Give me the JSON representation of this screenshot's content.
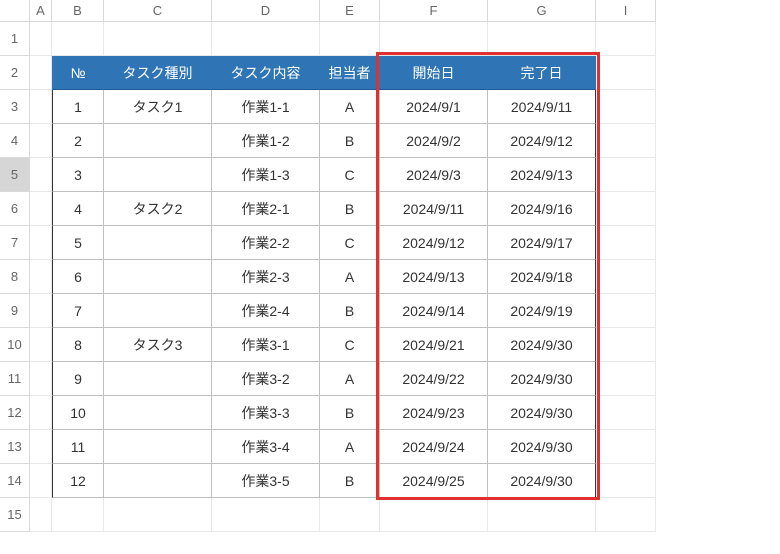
{
  "selected_row_header": 5,
  "col_letters": [
    "A",
    "B",
    "C",
    "D",
    "E",
    "F",
    "G",
    "I"
  ],
  "row_numbers_visible": [
    1,
    2,
    3,
    4,
    5,
    6,
    7,
    8,
    9,
    10,
    11,
    12,
    13,
    14,
    15
  ],
  "table": {
    "headers": {
      "no": "№",
      "type": "タスク種別",
      "content": "タスク内容",
      "owner": "担当者",
      "start": "開始日",
      "end": "完了日"
    },
    "groups": [
      {
        "type_label": "タスク1",
        "rows": [
          {
            "no": 1,
            "content": "作業1-1",
            "owner": "A",
            "start": "2024/9/1",
            "end": "2024/9/11"
          },
          {
            "no": 2,
            "content": "作業1-2",
            "owner": "B",
            "start": "2024/9/2",
            "end": "2024/9/12"
          },
          {
            "no": 3,
            "content": "作業1-3",
            "owner": "C",
            "start": "2024/9/3",
            "end": "2024/9/13"
          }
        ]
      },
      {
        "type_label": "タスク2",
        "rows": [
          {
            "no": 4,
            "content": "作業2-1",
            "owner": "B",
            "start": "2024/9/11",
            "end": "2024/9/16"
          },
          {
            "no": 5,
            "content": "作業2-2",
            "owner": "C",
            "start": "2024/9/12",
            "end": "2024/9/17"
          },
          {
            "no": 6,
            "content": "作業2-3",
            "owner": "A",
            "start": "2024/9/13",
            "end": "2024/9/18"
          },
          {
            "no": 7,
            "content": "作業2-4",
            "owner": "B",
            "start": "2024/9/14",
            "end": "2024/9/19"
          }
        ]
      },
      {
        "type_label": "タスク3",
        "rows": [
          {
            "no": 8,
            "content": "作業3-1",
            "owner": "C",
            "start": "2024/9/21",
            "end": "2024/9/30"
          },
          {
            "no": 9,
            "content": "作業3-2",
            "owner": "A",
            "start": "2024/9/22",
            "end": "2024/9/30"
          },
          {
            "no": 10,
            "content": "作業3-3",
            "owner": "B",
            "start": "2024/9/23",
            "end": "2024/9/30"
          },
          {
            "no": 11,
            "content": "作業3-4",
            "owner": "A",
            "start": "2024/9/24",
            "end": "2024/9/30"
          },
          {
            "no": 12,
            "content": "作業3-5",
            "owner": "B",
            "start": "2024/9/25",
            "end": "2024/9/30"
          }
        ]
      }
    ]
  },
  "highlight_columns": [
    "F",
    "G"
  ]
}
